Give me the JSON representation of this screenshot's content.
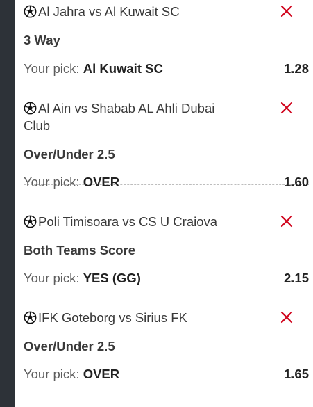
{
  "pick_prefix": "Your pick:",
  "colors": {
    "remove": "#d0021b",
    "rail": "#2d3238",
    "divider": "#bdbdbd"
  },
  "bets": [
    {
      "match": "Al Jahra vs Al Kuwait SC",
      "market": "3 Way",
      "pick": "Al Kuwait SC",
      "odds": "1.28"
    },
    {
      "match": "Al Ain vs Shabab AL Ahli Dubai Club",
      "market": "Over/Under 2.5",
      "pick": "OVER",
      "odds": "1.60"
    },
    {
      "match": "Poli Timisoara vs CS U Craiova",
      "market": "Both Teams Score",
      "pick": "YES (GG)",
      "odds": "2.15"
    },
    {
      "match": "IFK Goteborg vs Sirius FK",
      "market": "Over/Under 2.5",
      "pick": "OVER",
      "odds": "1.65"
    }
  ]
}
